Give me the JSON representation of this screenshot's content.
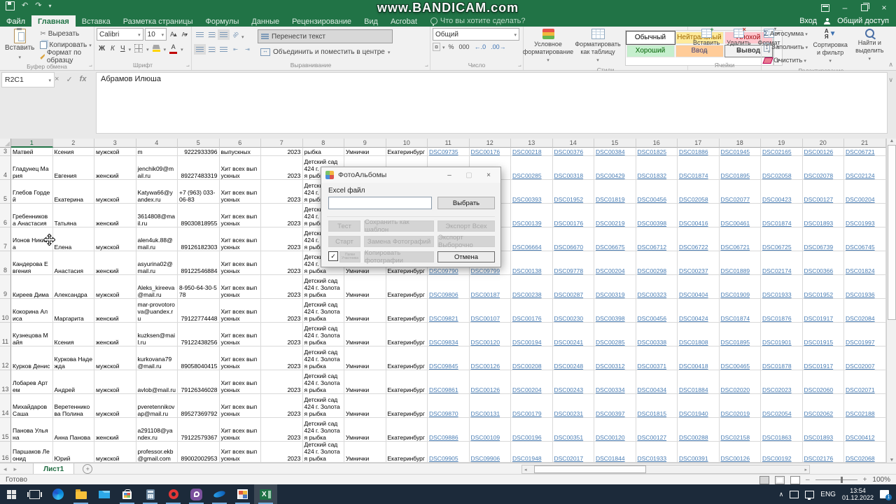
{
  "title_bar": {
    "watermark": "www.BANDICAM.com"
  },
  "ribbon_tabs": {
    "items": [
      "Файл",
      "Главная",
      "Вставка",
      "Разметка страницы",
      "Формулы",
      "Данные",
      "Рецензирование",
      "Вид",
      "Acrobat"
    ],
    "active": "Главная",
    "tell_me": "Что вы хотите сделать?",
    "sign_in": "Вход",
    "share": "Общий доступ"
  },
  "ribbon": {
    "clipboard": {
      "paste": "Вставить",
      "cut": "Вырезать",
      "copy": "Копировать",
      "format_painter": "Формат по образцу",
      "label": "Буфер обмена"
    },
    "font": {
      "family": "Calibri",
      "size": "10",
      "label": "Шрифт"
    },
    "alignment": {
      "wrap": "Перенести текст",
      "merge": "Объединить и поместить в центре",
      "label": "Выравнивание"
    },
    "number": {
      "format": "Общий",
      "thousands": "000",
      "percent": "%",
      "label": "Число"
    },
    "styles": {
      "conditional": "Условное форматирование",
      "format_table": "Форматировать как таблицу",
      "label": "Стили",
      "gallery": [
        {
          "label": "Обычный",
          "bg": "#ffffff",
          "fg": "#000000",
          "selected": true
        },
        {
          "label": "Нейтральный",
          "bg": "#ffeb9c",
          "fg": "#9c6500",
          "selected": false
        },
        {
          "label": "Плохой",
          "bg": "#ffc7ce",
          "fg": "#9c0006",
          "selected": false
        },
        {
          "label": "Хороший",
          "bg": "#c6efce",
          "fg": "#006100",
          "selected": false
        },
        {
          "label": "Ввод",
          "bg": "#ffcc99",
          "fg": "#3f3f76",
          "selected": false
        },
        {
          "label": "Вывод",
          "bg": "#f2f2f2",
          "fg": "#3f3f3f",
          "selected": false
        }
      ]
    },
    "cells": {
      "insert": "Вставить",
      "delete": "Удалить",
      "format": "Формат",
      "label": "Ячейки"
    },
    "editing": {
      "autosum": "Автосумма",
      "fill": "Заполнить",
      "clear": "Очистить",
      "sort": "Сортировка и фильтр",
      "find": "Найти и выделить",
      "label": "Редактирование"
    }
  },
  "formula_bar": {
    "name_box": "R2C1",
    "fx": "fx",
    "value": "Абрамов Илюша"
  },
  "grid": {
    "columns": [
      "1",
      "2",
      "3",
      "4",
      "5",
      "6",
      "7",
      "8",
      "9",
      "10",
      "11",
      "12",
      "13",
      "14",
      "15",
      "16",
      "17",
      "18",
      "19",
      "20",
      "21"
    ],
    "selected_column": "1",
    "rows": [
      {
        "n": "3",
        "cells": [
          "Матвей",
          "Ксения",
          "мужской",
          "m",
          "9222933396",
          "выпускных",
          "2023",
          "рыбка",
          "Умнички",
          "Екатеринбург",
          "DSC09735",
          "DSC00176",
          "DSC00218",
          "DSC00376",
          "DSC00384",
          "DSC01825",
          "DSC01886",
          "DSC01945",
          "DSC02165",
          "DSC00126",
          "DSC06721"
        ]
      },
      {
        "n": "4",
        "cells": [
          "Гладунец Мария",
          "Евгения",
          "женский",
          "jenchik09@mail.ru",
          "89227483319",
          "Хит всех выпускных",
          "2023",
          "Детский сад 424 г. Золотая рыбка",
          "Умнички",
          "Екатеринбург",
          "",
          "",
          "DSC00285",
          "DSC00318",
          "DSC00429",
          "DSC01832",
          "DSC01874",
          "DSC01895",
          "DSC02058",
          "DSC02078",
          "DSC02124"
        ]
      },
      {
        "n": "5",
        "cells": [
          "Глебов Гордей",
          "Екатерина",
          "мужской",
          "Katywa66@yandex.ru",
          "+7 (963) 033-06-83",
          "Хит всех выпускных",
          "2023",
          "Детский сад 424 г. Золотая рыбка",
          "Умнички",
          "Екатеринбург",
          "",
          "",
          "DSC00393",
          "DSC01952",
          "DSC01819",
          "DSC00456",
          "DSC02058",
          "DSC02077",
          "DSC00423",
          "DSC00127",
          "DSC00204"
        ]
      },
      {
        "n": "6",
        "cells": [
          "Гребенникова Анастасия",
          "Татьяна",
          "женский",
          "3614808@mail.ru",
          "89030818955",
          "Хит всех выпускных",
          "2023",
          "Детский сад 424 г. Золотая рыбка",
          "Умнички",
          "Екатеринбург",
          "",
          "",
          "DSC00139",
          "DSC00176",
          "DSC00219",
          "DSC00398",
          "DSC00416",
          "DSC00461",
          "DSC01874",
          "DSC01893",
          "DSC01993"
        ]
      },
      {
        "n": "7",
        "cells": [
          "Ионов Никита",
          "Елена",
          "мужской",
          "alen4uk.88@mail.ru",
          "89126182303",
          "Хит всех выпускных",
          "2023",
          "Детский сад 424 г. Золотая рыбка",
          "Умнички",
          "Екатеринбург",
          "",
          "",
          "DSC06664",
          "DSC06670",
          "DSC06675",
          "DSC06712",
          "DSC06722",
          "DSC06721",
          "DSC06725",
          "DSC06739",
          "DSC06745"
        ]
      },
      {
        "n": "8",
        "cells": [
          "Кандерова Евгения",
          "Анастасия",
          "женский",
          "asyurina02@mail.ru",
          "89122546884",
          "Хит всех выпускных",
          "2023",
          "Детский сад 424 г. Золотая рыбка",
          "Умнички",
          "Екатеринбург",
          "DSC09790",
          "DSC09799",
          "DSC00138",
          "DSC09778",
          "DSC00204",
          "DSC00298",
          "DSC00237",
          "DSC01889",
          "DSC02174",
          "DSC00366",
          "DSC01824"
        ]
      },
      {
        "n": "9",
        "cells": [
          "Киреев Дима",
          "Александра",
          "мужской",
          "Aleks_kireeva@mail.ru",
          "8-950-64-30-578",
          "Хит всех выпускных",
          "2023",
          "Детский сад 424 г. Золотая рыбка",
          "Умнички",
          "Екатеринбург",
          "DSC09806",
          "DSC00187",
          "DSC00238",
          "DSC00287",
          "DSC00319",
          "DSC00323",
          "DSC00404",
          "DSC01909",
          "DSC01933",
          "DSC01952",
          "DSC01936"
        ]
      },
      {
        "n": "10",
        "cells": [
          "Кокорина Алиса",
          "Маргарита",
          "женский",
          "mar-provotorova@uandex.ru",
          "79122774448",
          "Хит всех выпускных",
          "2023",
          "Детский сад 424 г. Золотая рыбка",
          "Умнички",
          "Екатеринбург",
          "DSC09821",
          "DSC00107",
          "DSC00176",
          "DSC00230",
          "DSC00398",
          "DSC00456",
          "DSC00424",
          "DSC01874",
          "DSC01876",
          "DSC01917",
          "DSC02084"
        ]
      },
      {
        "n": "11",
        "cells": [
          "Кузнецова Майя",
          "Ксения",
          "женский",
          "kuzksen@mail.ru",
          "79122438256",
          "Хит всех выпускных",
          "2023",
          "Детский сад 424 г. Золотая рыбка",
          "Умнички",
          "Екатеринбург",
          "DSC09834",
          "DSC00120",
          "DSC00194",
          "DSC00241",
          "DSC00285",
          "DSC00338",
          "DSC01808",
          "DSC01895",
          "DSC01901",
          "DSC01915",
          "DSC01997"
        ]
      },
      {
        "n": "12",
        "cells": [
          "Курков Денис",
          "Куркова Надежда",
          "мужской",
          "kurkovana79@mail.ru",
          "89058040415",
          "Хит всех выпускных",
          "2023",
          "Детский сад 424 г. Золотая рыбка",
          "Умнички",
          "Екатеринбург",
          "DSC09845",
          "DSC00126",
          "DSC00208",
          "DSC00248",
          "DSC00312",
          "DSC00371",
          "DSC00418",
          "DSC00465",
          "DSC01878",
          "DSC01917",
          "DSC02007"
        ]
      },
      {
        "n": "13",
        "cells": [
          "Лобарев Артем",
          "Андрей",
          "мужской",
          "avlob@mail.ru",
          "79126346028",
          "Хит всех выпускных",
          "2023",
          "Детский сад 424 г. Золотая рыбка",
          "Умнички",
          "Екатеринбург",
          "DSC09861",
          "DSC00126",
          "DSC00204",
          "DSC00243",
          "DSC00334",
          "DSC00434",
          "DSC01884",
          "DSC02020",
          "DSC02023",
          "DSC02060",
          "DSC02071"
        ]
      },
      {
        "n": "14",
        "cells": [
          "Михайдаров Саша",
          "Веретенникова Полина",
          "мужской",
          "pveretennikovap@mail.ru",
          "89527369792",
          "Хит всех выпускных",
          "2023",
          "Детский сад 424 г. Золотая рыбка",
          "Умнички",
          "Екатеринбург",
          "DSC09870",
          "DSC00131",
          "DSC00179",
          "DSC00231",
          "DSC00397",
          "DSC01815",
          "DSC01940",
          "DSC02019",
          "DSC02054",
          "DSC02062",
          "DSC02188"
        ]
      },
      {
        "n": "15",
        "cells": [
          "Панова Ульяна",
          "Анна Панова",
          "женский",
          "a291108@yandex.ru",
          "79122579367",
          "Хит всех выпускных",
          "2023",
          "Детский сад 424 г. Золотая рыбка",
          "Умнички",
          "Екатеринбург",
          "DSC09886",
          "DSC00109",
          "DSC00196",
          "DSC00351",
          "DSC00120",
          "DSC00127",
          "DSC00288",
          "DSC02158",
          "DSC01863",
          "DSC01893",
          "DSC00412"
        ]
      },
      {
        "n": "16",
        "cells": [
          "Паршаков Леонид",
          "Юрий",
          "мужской",
          "professor.ekb@gmail.com",
          "89002002953",
          "Хит всех выпускных",
          "2023",
          "Детский сад 424 г. Золотая рыбка",
          "Умнички",
          "Екатеринбург",
          "DSC09905",
          "DSC09906",
          "DSC01948",
          "DSC02017",
          "DSC01844",
          "DSC01933",
          "DSC00391",
          "DSC00126",
          "DSC00192",
          "DSC02176",
          "DSC02068"
        ]
      }
    ]
  },
  "dialog": {
    "title": "ФотоАльбомы",
    "file_label": "Excel файл",
    "choose": "Выбрать",
    "test": "Тест",
    "save_template": "Сохранить как шаблон",
    "export_all": "Экспорт Всех",
    "start": "Старт",
    "replace_photos": "Замена Фотографий",
    "export_selected": "Экспорт Выборочно",
    "folders_label": "Папки Участника",
    "copy_photos": "Копировать фотографии",
    "cancel": "Отмена"
  },
  "sheet_bar": {
    "tab": "Лист1"
  },
  "status_bar": {
    "ready": "Готово",
    "zoom": "100%"
  },
  "taskbar": {
    "icons": [
      "start",
      "task-view",
      "edge",
      "file-explorer",
      "mail",
      "store",
      "calculator",
      "opera",
      "viber",
      "photo-viewer",
      "photo-album-app",
      "excel"
    ],
    "lang": "ENG",
    "time": "13:54",
    "date": "01.12.2022",
    "notification_count": "1"
  }
}
